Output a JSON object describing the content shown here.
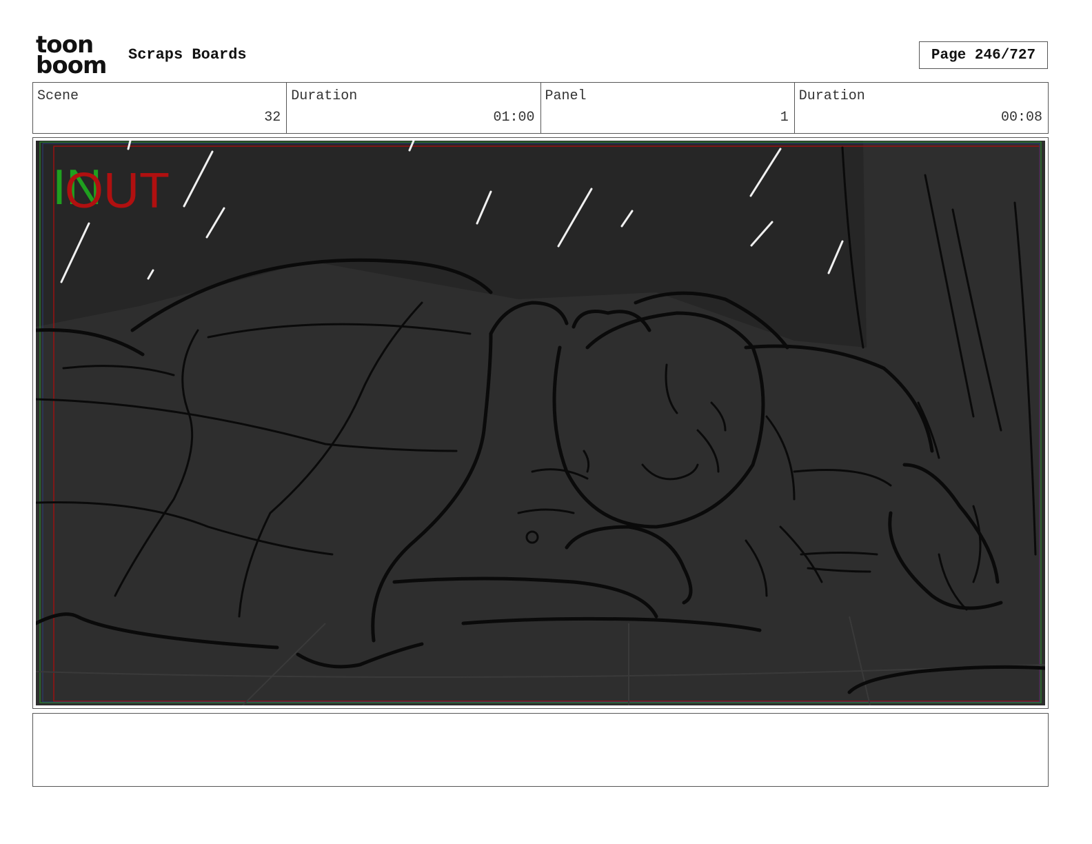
{
  "header": {
    "logo_line1": "toon",
    "logo_line2": "boom",
    "project_title": "Scraps Boards",
    "page_label": "Page 246/727"
  },
  "info": {
    "scene_label": "Scene",
    "scene_value": "32",
    "scene_duration_label": "Duration",
    "scene_duration_value": "01:00",
    "panel_label": "Panel",
    "panel_value": "1",
    "panel_duration_label": "Duration",
    "panel_duration_value": "00:08"
  },
  "panel": {
    "in_marker": "IN",
    "out_marker": "OUT",
    "in_color": "#1fa01f",
    "out_color": "#b01010",
    "background_color": "#2e2e2e"
  },
  "notes": {
    "text": ""
  }
}
